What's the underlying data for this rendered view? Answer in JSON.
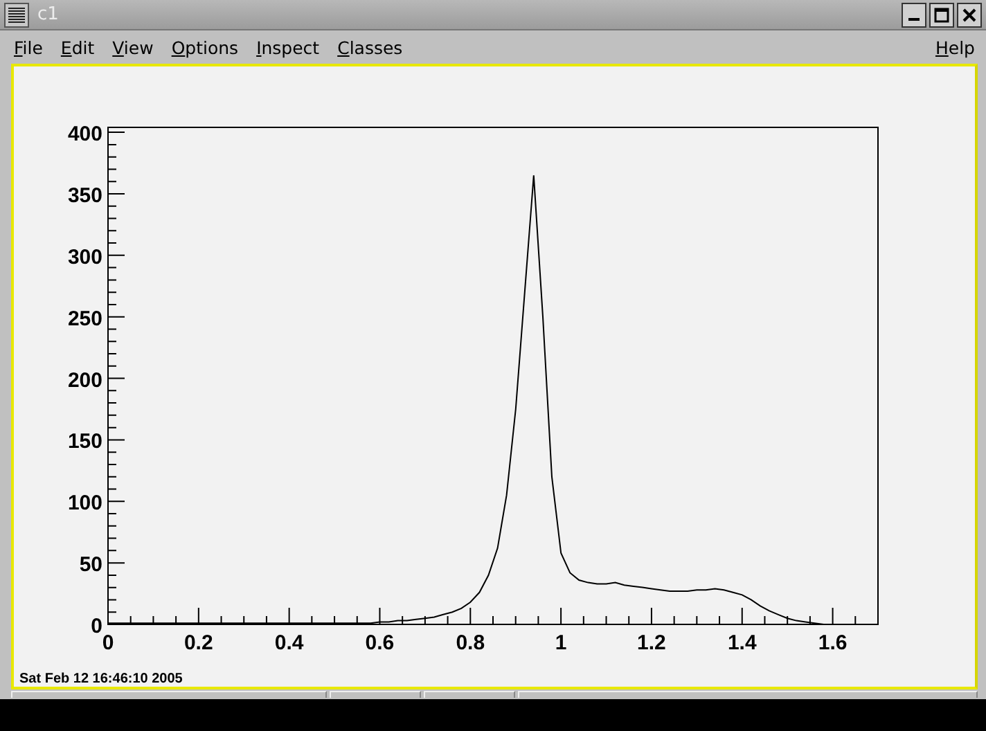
{
  "window": {
    "title": "c1"
  },
  "menu": [
    {
      "label": "File"
    },
    {
      "label": "Edit"
    },
    {
      "label": "View"
    },
    {
      "label": "Options"
    },
    {
      "label": "Inspect"
    },
    {
      "label": "Classes"
    },
    {
      "label": "Help"
    }
  ],
  "canvas": {
    "timestamp": "Sat Feb 12 16:46:10 2005",
    "chart_data": {
      "type": "line",
      "xlim": [
        0,
        1.7
      ],
      "ylim": [
        0,
        404
      ],
      "xticks": [
        0,
        0.2,
        0.4,
        0.6,
        0.8,
        1,
        1.2,
        1.4,
        1.6
      ],
      "yticks": [
        0,
        50,
        100,
        150,
        200,
        250,
        300,
        350,
        400
      ],
      "x": [
        0,
        0.02,
        0.04,
        0.06,
        0.08,
        0.1,
        0.12,
        0.14,
        0.16,
        0.18,
        0.2,
        0.22,
        0.24,
        0.26,
        0.28,
        0.3,
        0.32,
        0.34,
        0.36,
        0.38,
        0.4,
        0.42,
        0.44,
        0.46,
        0.48,
        0.5,
        0.52,
        0.54,
        0.56,
        0.58,
        0.6,
        0.62,
        0.64,
        0.66,
        0.68,
        0.7,
        0.72,
        0.74,
        0.76,
        0.78,
        0.8,
        0.82,
        0.84,
        0.86,
        0.88,
        0.9,
        0.92,
        0.94,
        0.96,
        0.98,
        1,
        1.02,
        1.04,
        1.06,
        1.08,
        1.1,
        1.12,
        1.14,
        1.16,
        1.18,
        1.2,
        1.22,
        1.24,
        1.26,
        1.28,
        1.3,
        1.32,
        1.34,
        1.36,
        1.38,
        1.4,
        1.42,
        1.44,
        1.46,
        1.48,
        1.5,
        1.52,
        1.54,
        1.56,
        1.58,
        1.6
      ],
      "series": [
        {
          "color": "#000000",
          "values": [
            1,
            1,
            1,
            1,
            1,
            1,
            1,
            1,
            1,
            1,
            1,
            1,
            1,
            1,
            1,
            1,
            1,
            1,
            1,
            1,
            1,
            1,
            1,
            1,
            1,
            1,
            1,
            1,
            1,
            1,
            2,
            2,
            3,
            3,
            4,
            5,
            6,
            8,
            10,
            13,
            18,
            26,
            40,
            62,
            105,
            175,
            270,
            365,
            250,
            120,
            58,
            42,
            36,
            34,
            33,
            33,
            34,
            32,
            31,
            30,
            29,
            28,
            27,
            27,
            27,
            28,
            28,
            29,
            28,
            26,
            24,
            20,
            15,
            11,
            8,
            5,
            3,
            2,
            1,
            0,
            0
          ]
        }
      ]
    }
  }
}
